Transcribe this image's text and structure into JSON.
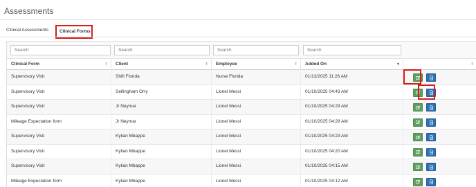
{
  "page": {
    "title": "Assessments"
  },
  "tabs": [
    {
      "label": "Clinical Assessments",
      "active": false
    },
    {
      "label": "Clinical Forms",
      "active": true
    }
  ],
  "search": {
    "placeholder_form": "Search",
    "placeholder_client": "Search",
    "placeholder_employee": "Search",
    "placeholder_added": "Search"
  },
  "columns": {
    "form": "Clinical Form",
    "client": "Client",
    "employee": "Employee",
    "added": "Added On"
  },
  "rows": [
    {
      "form": "Supervisory Visit",
      "client": "Shift Florida",
      "employee": "Nurse Florida",
      "added": "01/13/2025 11:26 AM"
    },
    {
      "form": "Supervisory Visit",
      "client": "Sellingham Orry",
      "employee": "Lionel Messi",
      "added": "01/10/2025 04:43 AM"
    },
    {
      "form": "Supervisory Visit",
      "client": "Jr Neymar",
      "employee": "Lionel Messi",
      "added": "01/10/2025 04:29 AM"
    },
    {
      "form": "Mileage Expectation form",
      "client": "Jr Neymar",
      "employee": "Lionel Messi",
      "added": "01/10/2025 04:28 AM"
    },
    {
      "form": "Supervisory Visit",
      "client": "Kylian Mbappe",
      "employee": "Lionel Messi",
      "added": "01/10/2025 04:23 AM"
    },
    {
      "form": "Supervisory Visit",
      "client": "Kylian Mbappe",
      "employee": "Lionel Messi",
      "added": "01/10/2025 04:20 AM"
    },
    {
      "form": "Supervisory Visit",
      "client": "Kylian Mbappe",
      "employee": "Lionel Messi",
      "added": "01/10/2025 04:15 AM"
    },
    {
      "form": "Mileage Expectation form",
      "client": "Kylian Mbappe",
      "employee": "Lionel Messi",
      "added": "01/10/2025 04:12 AM"
    }
  ],
  "icons": {
    "edit": "edit-icon",
    "document": "document-icon",
    "sort": "sort-icon",
    "sort_desc": "sort-desc-icon"
  },
  "colors": {
    "edit_button": "#5f9e63",
    "doc_button": "#2f72b4",
    "highlight": "#d81b1b"
  }
}
